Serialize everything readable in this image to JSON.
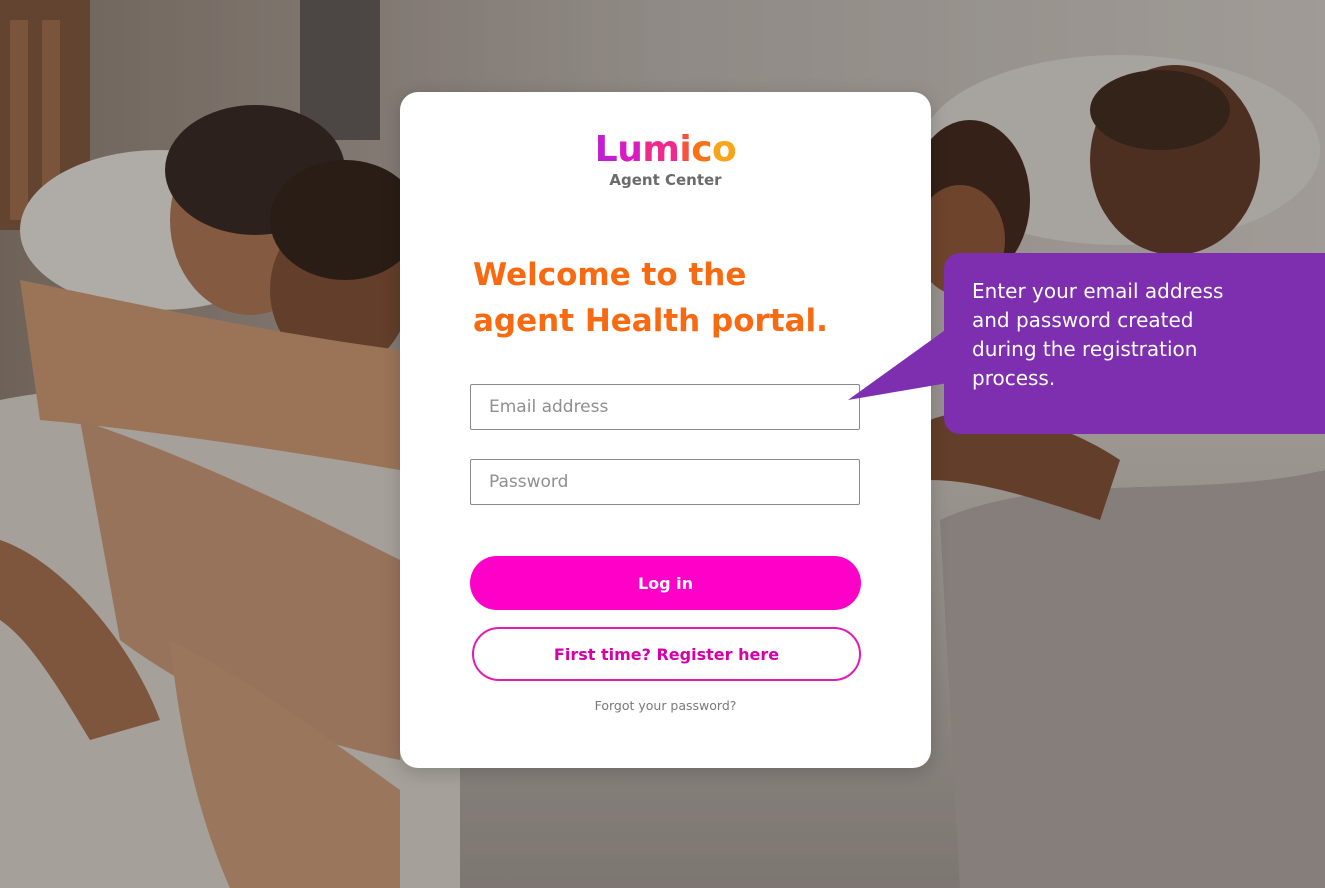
{
  "logo": {
    "letters": [
      "L",
      "u",
      "m",
      "i",
      "c",
      "o"
    ],
    "letter_colors": [
      "#c11fd0",
      "#d81cc3",
      "#ee2a8c",
      "#f5533f",
      "#f97316",
      "#f9a51a"
    ],
    "subtitle": "Agent Center"
  },
  "welcome": {
    "line1": "Welcome to the",
    "line2": "agent Health portal."
  },
  "form": {
    "email_placeholder": "Email address",
    "email_value": "",
    "password_placeholder": "Password",
    "password_value": "",
    "login_label": "Log in",
    "register_label": "First time? Register here",
    "forgot_label": "Forgot your password?"
  },
  "callout": {
    "lines": [
      "Enter your email address",
      "and password created",
      "during the registration",
      "process."
    ]
  },
  "colors": {
    "heading": "#f76a12",
    "primary_button": "#ff00c8",
    "register_border": "#e01cb3",
    "callout_bg": "#7d2fb0"
  }
}
